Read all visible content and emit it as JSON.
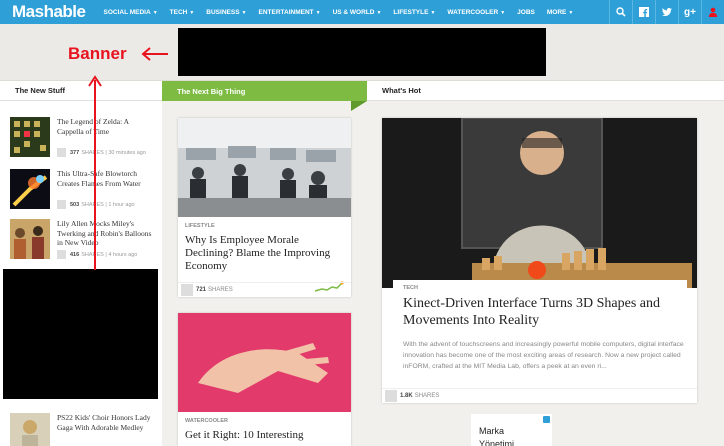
{
  "nav": {
    "logo": "Mashable",
    "items": [
      "SOCIAL MEDIA",
      "TECH",
      "BUSINESS",
      "ENTERTAINMENT",
      "US & WORLD",
      "LIFESTYLE",
      "WATERCOOLER",
      "JOBS",
      "MORE"
    ],
    "carets": [
      true,
      true,
      true,
      true,
      true,
      true,
      true,
      false,
      true
    ]
  },
  "annotation": {
    "banner_label": "Banner"
  },
  "columns": {
    "new_stuff": "The New Stuff",
    "next_big": "The Next Big Thing",
    "whats_hot": "What's Hot"
  },
  "new_stuff": [
    {
      "title": "The Legend of Zelda: A Cappella of Time",
      "shares": "377",
      "shares_label": "SHARES",
      "time": "30 minutes ago"
    },
    {
      "title": "This Ultra-Safe Blowtorch Creates Flames From Water",
      "shares": "503",
      "shares_label": "SHARES",
      "time": "1 hour ago"
    },
    {
      "title": "Lily Allen Mocks Miley's Twerking and Robin's Balloons in New Video",
      "shares": "416",
      "shares_label": "SHARES",
      "time": "4 hours ago"
    },
    {
      "title": "PS22 Kids' Choir Honors Lady Gaga With Adorable Medley"
    }
  ],
  "next_big": [
    {
      "tag": "LIFESTYLE",
      "headline": "Why Is Employee Morale Declining? Blame the Improving Economy",
      "shares": "721",
      "shares_label": "SHARES"
    },
    {
      "tag": "WATERCOOLER",
      "headline": "Get it Right: 10 Interesting"
    }
  ],
  "hot": {
    "tag": "TECH",
    "headline": "Kinect-Driven Interface Turns 3D Shapes and Movements Into Reality",
    "excerpt": "With the advent of touchscreens and increasingly powerful mobile computers, digital interface innovation has become one of the most exciting areas of research. Now a new project called inFORM, crafted at the MIT Media Lab, offers a peek at an even ri...",
    "shares": "1.8K",
    "shares_label": "SHARES"
  },
  "small_ad": {
    "line1": "Marka",
    "line2": "Yönetimi"
  },
  "colors": {
    "nav": "#2fa0d7",
    "next_big": "#7dbb42",
    "annotation": "#e8131f"
  },
  "icons": [
    "search-icon",
    "facebook-icon",
    "twitter-icon",
    "google-plus-icon",
    "user-icon",
    "share-icon"
  ]
}
